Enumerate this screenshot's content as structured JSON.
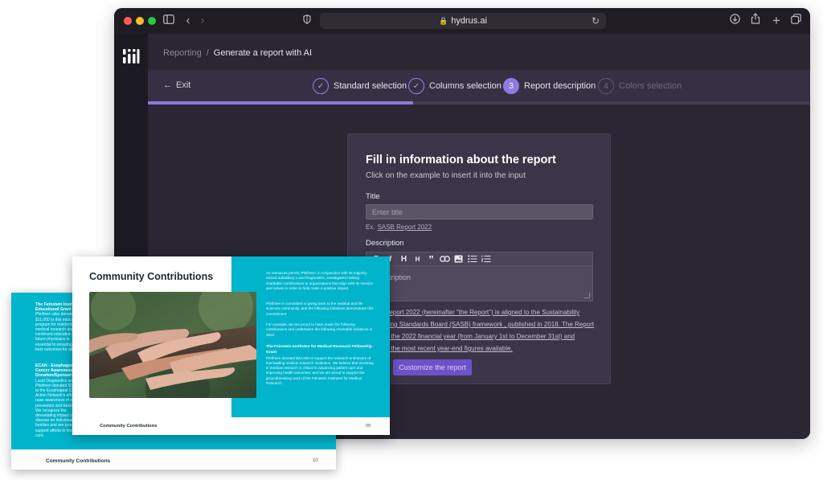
{
  "browser": {
    "url": "hydrus.ai"
  },
  "app": {
    "breadcrumb": {
      "parent": "Reporting",
      "separator": "/",
      "current": "Generate a report with AI"
    },
    "wizard": {
      "exit_label": "Exit",
      "progress_percent": 40,
      "steps": [
        {
          "label": "Standard selection",
          "state": "done",
          "marker": "✓"
        },
        {
          "label": "Columns selection",
          "state": "done",
          "marker": "✓"
        },
        {
          "label": "Report description",
          "state": "active",
          "marker": "3"
        },
        {
          "label": "Colors selection",
          "state": "todo",
          "marker": "4"
        }
      ]
    },
    "form": {
      "heading": "Fill in information about the report",
      "subheading": "Click on the example to insert it into the input",
      "title_label": "Title",
      "title_placeholder": "Enter title",
      "title_example_prefix": "Ex.",
      "title_example": "SASB Report 2022",
      "description_label": "Description",
      "description_placeholder": "Description",
      "description_example": "SASB Report 2022 (hereinafter \"the Report\") is aligned to the Sustainability Accounting Standards Board (SASB) framework , published in 2018. The Report refers to the 2022 financial year (from January 1st to December 31st) and includes the most recent year-end figures available.",
      "submit_label": "Customize the report",
      "toolbar": [
        "bold",
        "italic",
        "heading-large",
        "heading-small",
        "quote",
        "link",
        "image",
        "bullet-list",
        "numbered-list"
      ]
    }
  },
  "report": {
    "front": {
      "title": "Community Contributions",
      "footer": "Community Contributions",
      "page": "09",
      "para1": "As resources permit, Pfeifmen, in conjunction with its majority-owned subsidiary Lucid Diagnostics, investigated making charitable contributions to organizations that align with its mission and values in order to help make a positive impact.",
      "para2": "Pfeifmen is committed to giving back to the medical and life sciences community, and the following initiatives demonstrate this commitment.",
      "para3": "For example, we are proud to have made the following contributions and undertaken the following charitable initiatives in 2022:",
      "heading": "The Feinstein Institutes for Medical Research Fellowship Grant",
      "para4": "Pfeifmen donated $22,000 to support the research endeavors of this leading medical research institution. We believe that investing in medical research is critical to advancing patient care and improving health outcomes, and we are proud to support the groundbreaking work of the Feinstein Institutes for Medical Research."
    },
    "back": {
      "footer": "Community Contributions",
      "page": "10",
      "heading1": "The Feinstein Institutes Educational Grant",
      "para1": "Pfeifmen also donated $11,000 to this educational program for residents, as medical research and continued education of future physicians is essential to ensuring the best outcomes for all.",
      "heading2": "ECAN - Esophageal Cancer Awareness Donation/Sponsorship",
      "para2": "Lucid Diagnostics and Pfeifmen donated $10,000 to the Esophageal Cancer Action Network's efforts to raise awareness of early prevention and treatment. We recognize the devastating impact of this disease on individuals and families and are proud to support efforts to find a cure."
    }
  }
}
